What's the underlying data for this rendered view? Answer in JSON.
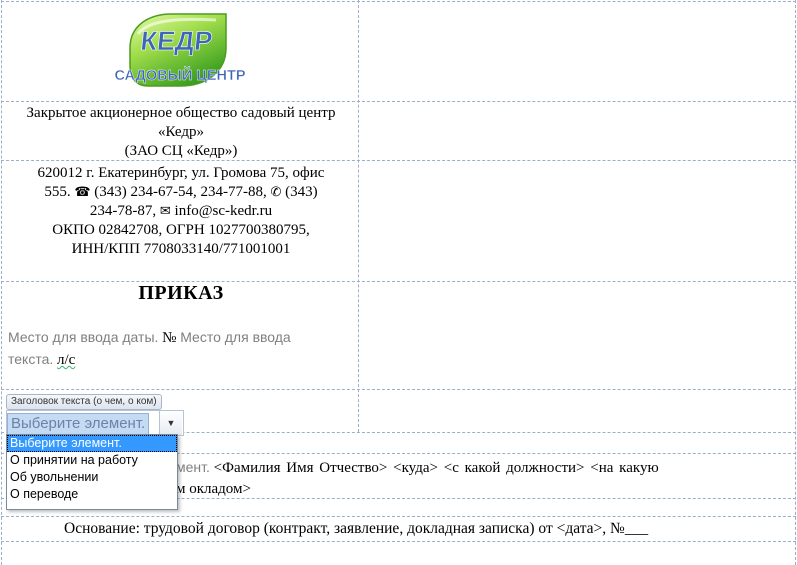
{
  "logo": {
    "brand": "КЕДР",
    "subtitle": "САДОВЫЙ ЦЕНТР",
    "colors": {
      "leaf_light": "#c9f07a",
      "leaf_dark": "#3a9e1f",
      "text_blue": "#3e66b8"
    }
  },
  "company": {
    "full_name": "Закрытое акционерное общество садовый центр «Кедр»",
    "short_name": "(ЗАО СЦ «Кедр»)"
  },
  "address": {
    "line1": "620012 г. Екатеринбург, ул. Громова 75, офис",
    "office_no": "555.",
    "phone": "(343) 234-67-54, 234-77-88,",
    "fax": "(343)",
    "fax2": "234-78-87,",
    "email": "info@sc-kedr.ru",
    "codes1": "ОКПО 02842708, ОГРН 1027700380795,",
    "codes2": "ИНН/КПП 7708033140/771001001"
  },
  "order": {
    "title": "ПРИКАЗ",
    "date_placeholder": "Место для ввода даты.",
    "number_sign": "№",
    "number_placeholder_1": "Место для ввода",
    "number_placeholder_2": "текста.",
    "suffix": "л/с"
  },
  "control": {
    "tag_label": "Заголовок текста (о чем, о ком)",
    "combo_value": "Выберите элемент.",
    "options": [
      "Выберите элемент.",
      "О принятии на работу",
      "Об увольнении",
      "О переводе"
    ],
    "selected_index": 0
  },
  "body": {
    "partial_placeholder": "мент.",
    "fields": "<Фамилия Имя Отчество>  <куда> <с какой должности>  <на какую",
    "line2": "м окладом>"
  },
  "basis": {
    "text": "Основание: трудовой договор (контракт, заявление, докладная записка) от <дата>, №___"
  }
}
